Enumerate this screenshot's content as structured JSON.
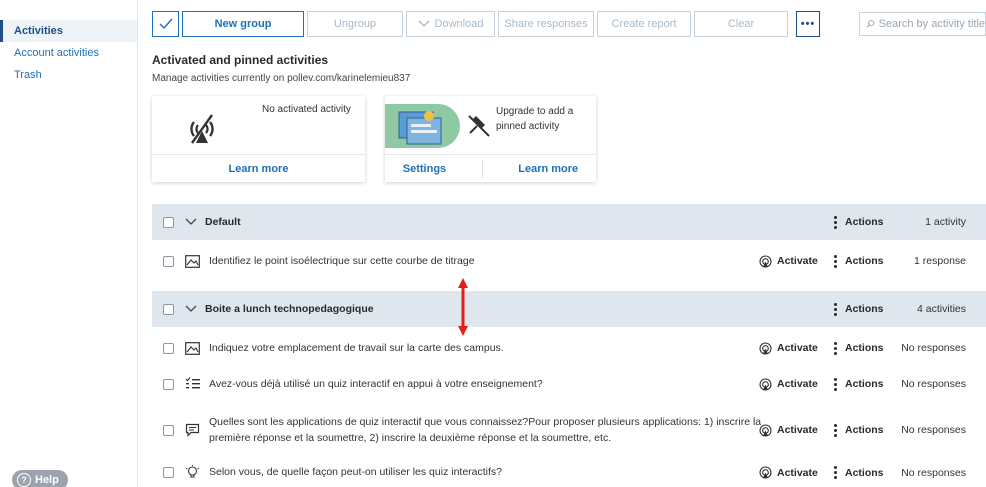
{
  "sidebar": {
    "items": [
      {
        "label": "Activities"
      },
      {
        "label": "Account activities"
      },
      {
        "label": "Trash"
      }
    ],
    "help_label": "Help"
  },
  "toolbar": {
    "new_group": "New group",
    "ungroup": "Ungroup",
    "download": "Download",
    "share_responses": "Share responses",
    "create_report": "Create report",
    "clear": "Clear",
    "more": "•••"
  },
  "search": {
    "placeholder": "Search by activity title"
  },
  "header": {
    "title": "Activated and pinned activities",
    "subtitle": "Manage activities currently on pollev.com/karinelemieu837"
  },
  "cards": {
    "activated": {
      "message": "No activated activity",
      "learn_more": "Learn more"
    },
    "pinned": {
      "message": "Upgrade to add a pinned activity",
      "settings": "Settings",
      "learn_more": "Learn more"
    }
  },
  "groups": [
    {
      "name": "Default",
      "actions": "Actions",
      "count": "1 activity",
      "rows": [
        {
          "icon": "image-icon",
          "title": "Identifiez le point isoélectrique sur cette courbe de titrage",
          "activate": "Activate",
          "actions": "Actions",
          "count": "1 response"
        }
      ]
    },
    {
      "name": "Boite a lunch technopedagogique",
      "actions": "Actions",
      "count": "4 activities",
      "rows": [
        {
          "icon": "image-icon",
          "title": "Indiquez votre emplacement de travail sur la carte des campus.",
          "activate": "Activate",
          "actions": "Actions",
          "count": "No responses"
        },
        {
          "icon": "multiple-choice-icon",
          "title": "Avez-vous déjà utilisé un quiz interactif en appui à votre enseignement?",
          "activate": "Activate",
          "actions": "Actions",
          "count": "No responses"
        },
        {
          "icon": "open-ended-icon",
          "title": "Quelles sont les applications de quiz interactif que vous connaissez?Pour proposer plusieurs applications: 1) inscrire la",
          "title_line2": "première réponse et la soumettre, 2) inscrire la deuxième réponse et la soumettre, etc.",
          "activate": "Activate",
          "actions": "Actions",
          "count": "No responses"
        },
        {
          "icon": "lightbulb-icon",
          "title": "Selon vous, de quelle façon peut-on utiliser les quiz interactifs?",
          "activate": "Activate",
          "actions": "Actions",
          "count": "No responses"
        }
      ]
    }
  ],
  "colors": {
    "accent": "#1f6fb8",
    "group_bg": "#dfe6ed",
    "annotation": "#e0201b"
  }
}
